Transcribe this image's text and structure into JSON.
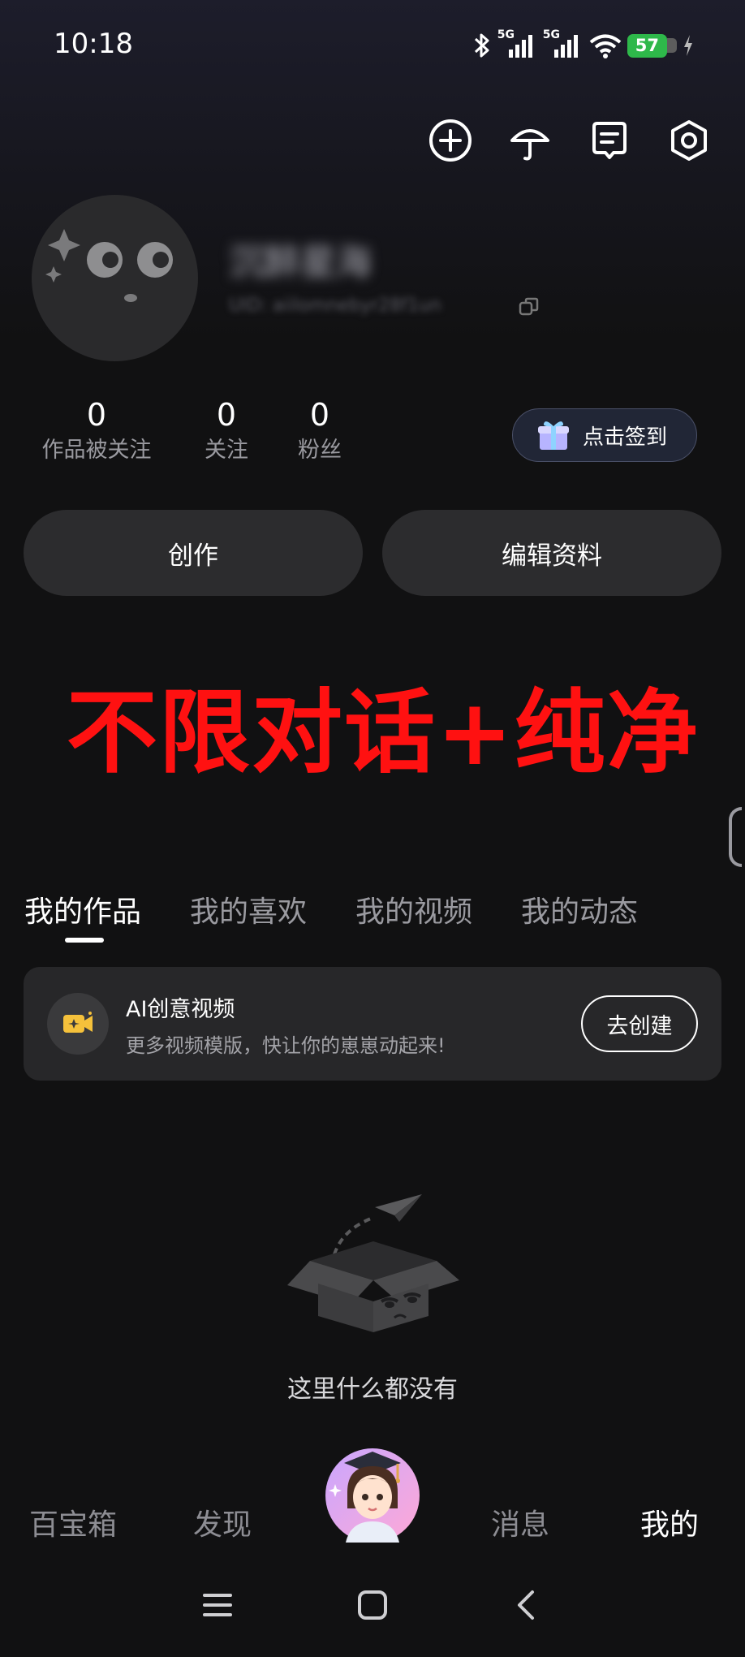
{
  "status_bar": {
    "time": "10:18",
    "network_1": "5G",
    "network_2": "5G",
    "battery": "57",
    "icons": [
      "bluetooth-icon",
      "signal-icon",
      "wifi-icon",
      "battery-icon",
      "charging-icon"
    ]
  },
  "top_actions": [
    "add-icon",
    "umbrella-icon",
    "note-icon",
    "settings-icon"
  ],
  "profile": {
    "name": "沉醉星海",
    "uid": "UID: aiilomnebyr28f1un"
  },
  "stats": [
    {
      "value": "0",
      "label": "作品被关注"
    },
    {
      "value": "0",
      "label": "关注"
    },
    {
      "value": "0",
      "label": "粉丝"
    }
  ],
  "checkin_label": "点击签到",
  "buttons": {
    "create": "创作",
    "edit_profile": "编辑资料"
  },
  "banner_text": "不限对话+纯净",
  "tabs": [
    {
      "label": "我的作品",
      "active": true
    },
    {
      "label": "我的喜欢",
      "active": false
    },
    {
      "label": "我的视频",
      "active": false
    },
    {
      "label": "我的动态",
      "active": false
    }
  ],
  "ai_card": {
    "title": "AI创意视频",
    "subtitle": "更多视频模版，快让你的崽崽动起来!",
    "button": "去创建"
  },
  "empty_state": "这里什么都没有",
  "bottom_nav": [
    {
      "label": "百宝箱",
      "active": false
    },
    {
      "label": "发现",
      "active": false
    },
    {
      "label": "消息",
      "active": false
    },
    {
      "label": "我的",
      "active": true
    }
  ],
  "colors": {
    "banner_red": "#ff1111",
    "battery_green": "#2eb84a",
    "card_bg": "#272729",
    "accent_yellow": "#f5c13b"
  }
}
